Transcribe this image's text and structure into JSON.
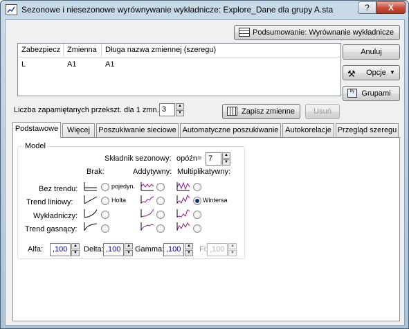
{
  "window": {
    "title": "Sezonowe i niesezonowe wyrównywanie wykładnicze: Explore_Dane dla grupy A.sta",
    "help": "?",
    "close": "X"
  },
  "buttons": {
    "summary": "Podsumowanie: Wyrównanie wykładnicze",
    "cancel": "Anuluj",
    "options": "Opcje",
    "groups": "Grupami",
    "save_vars": "Zapisz zmienne",
    "delete": "Usuń"
  },
  "list": {
    "headers": [
      "Zabezpiecz",
      "Zmienna",
      "Długa nazwa zmiennej (szeregu)"
    ],
    "rows": [
      [
        "L",
        "A1",
        "A1"
      ]
    ]
  },
  "transforms": {
    "label": "Liczba zapamiętanych przekszt. dla 1 zmn.:",
    "value": "3"
  },
  "tabs": [
    "Podstawowe",
    "Więcej",
    "Poszukiwanie sieciowe",
    "Automatyczne poszukiwanie",
    "Autokorelacje",
    "Przegląd szeregu"
  ],
  "model": {
    "group_label": "Model",
    "seasonal_label": "Składnik sezonowy:",
    "lag_label": "opóźn=",
    "lag_value": "7",
    "columns": [
      "Brak:",
      "Addytywny:",
      "Multiplikatywny:"
    ],
    "rows": [
      "Bez trendu:",
      "Trend liniowy:",
      "Wykładniczy:",
      "Trend gasnący:"
    ],
    "option_labels": {
      "simple": "pojedyn.",
      "holt": "Holta",
      "winters": "Wintersa"
    },
    "selected": {
      "row": 1,
      "col": 2
    }
  },
  "params": {
    "alpha_label": "Alfa:",
    "alpha": ",100",
    "delta_label": "Delta:",
    "delta": ",100",
    "gamma_label": "Gamma:",
    "gamma": ",100",
    "fi_label": "Fi:",
    "fi": ",100"
  },
  "colors": {
    "accent": "#1f2f6a",
    "purple_icon": "#8a1a8a",
    "value_blue": "#0000a8"
  }
}
